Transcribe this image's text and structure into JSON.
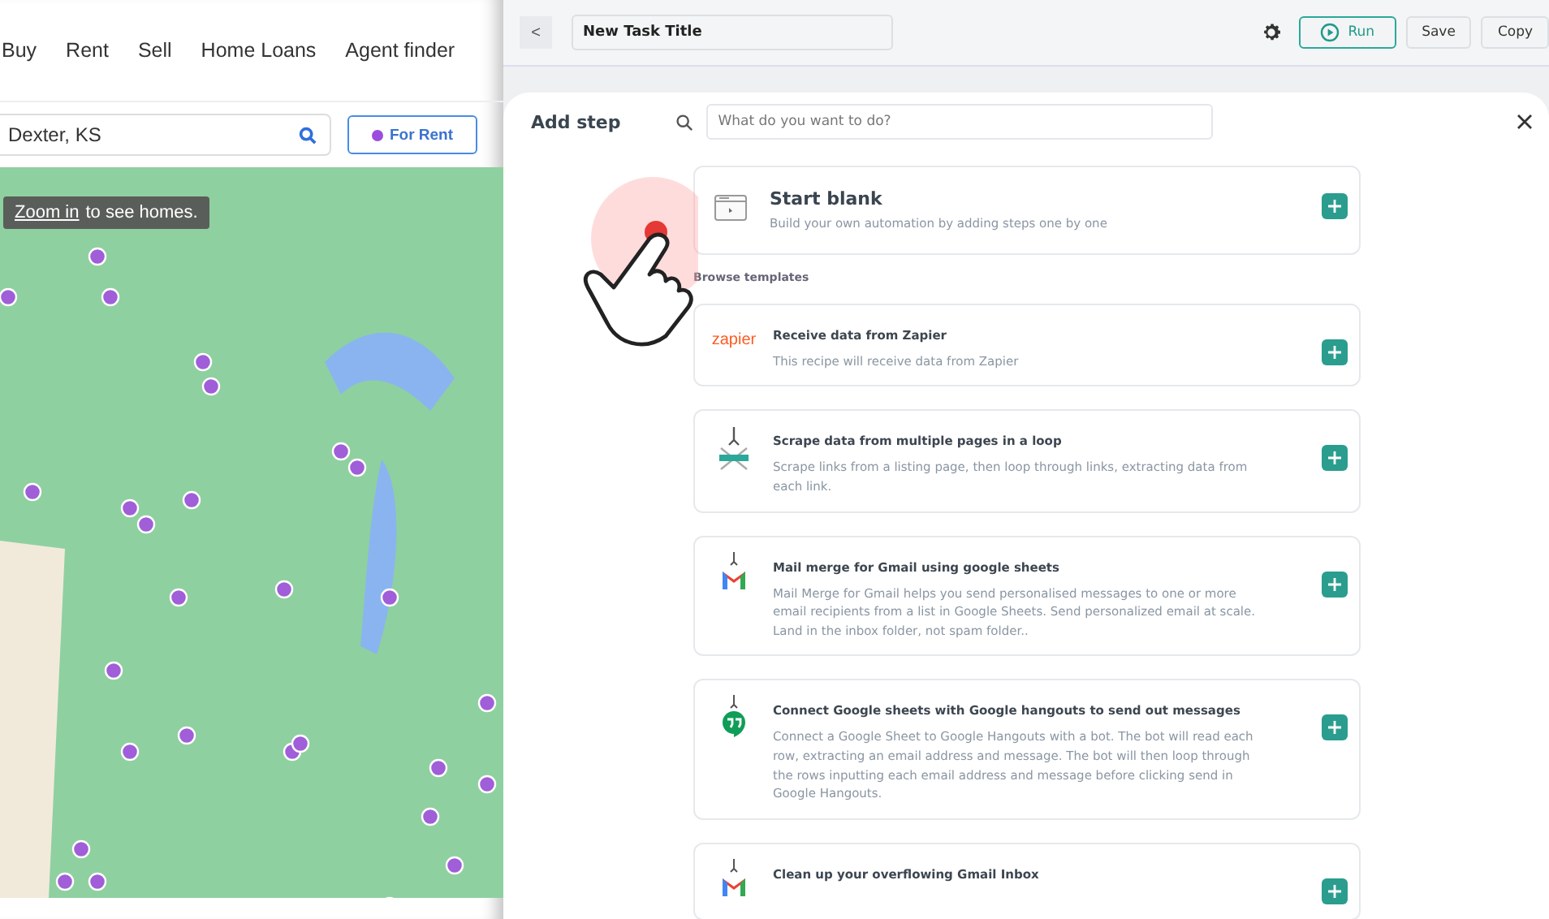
{
  "left_page": {
    "nav": [
      "Buy",
      "Rent",
      "Sell",
      "Home Loans",
      "Agent finder"
    ],
    "search": {
      "value": "Dexter, KS"
    },
    "filter_button": "For Rent",
    "map_tooltip": {
      "link": "Zoom in",
      "text": "to see homes."
    }
  },
  "toolbar": {
    "back": "<",
    "title_value": "New Task Title",
    "buttons": [
      {
        "label": "Run",
        "kind": "primary"
      },
      {
        "label": "Save",
        "kind": "plain"
      },
      {
        "label": "Copy",
        "kind": "plain"
      }
    ]
  },
  "panel": {
    "title": "Add step",
    "search": {
      "placeholder": "What do you want to do?"
    },
    "start": {
      "title": "Start blank",
      "description": "Build your own automation by adding steps one by one"
    },
    "section_label": "Browse templates",
    "templates": [
      {
        "kind": "zapier",
        "logo_text": "zapier",
        "title": "Receive data from Zapier",
        "description": "This recipe will receive data from Zapier"
      },
      {
        "kind": "scrape",
        "title": "Scrape data from multiple pages in a loop",
        "description": "Scrape links from a listing page, then loop through links, extracting data from each link."
      },
      {
        "kind": "gmail",
        "title": "Mail merge for Gmail using google sheets",
        "description": "Mail Merge for Gmail helps you send personalised messages to one or more email recipients from a list in Google Sheets. Send personalized email at scale. Land in the inbox folder, not spam folder.."
      },
      {
        "kind": "hangouts",
        "title": "Connect Google sheets with Google hangouts to send out messages",
        "description": "Connect a Google Sheet to Google Hangouts with a bot. The bot will read each row, extracting an email address and message. The bot will then loop through the rows inputting each email address and message before clicking send in Google Hangouts."
      },
      {
        "kind": "gmail",
        "title": "Clean up your overflowing Gmail Inbox"
      }
    ]
  }
}
